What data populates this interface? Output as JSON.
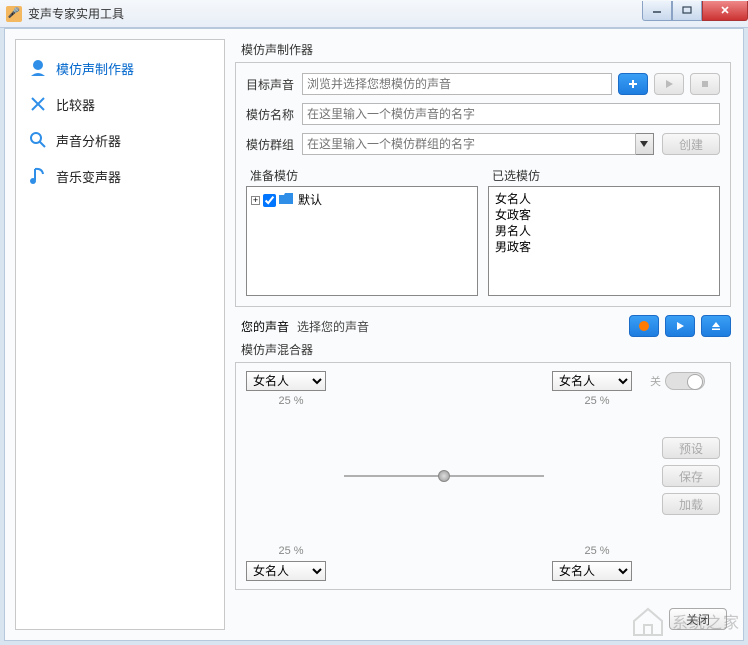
{
  "window": {
    "title": "变声专家实用工具"
  },
  "sidebar": {
    "items": [
      {
        "label": "模仿声制作器"
      },
      {
        "label": "比较器"
      },
      {
        "label": "声音分析器"
      },
      {
        "label": "音乐变声器"
      }
    ]
  },
  "maker": {
    "section_title": "模仿声制作器",
    "target_label": "目标声音",
    "target_placeholder": "浏览并选择您想模仿的声音",
    "name_label": "模仿名称",
    "name_placeholder": "在这里输入一个模仿声音的名字",
    "group_label": "模仿群组",
    "group_placeholder": "在这里输入一个模仿群组的名字",
    "create_btn": "创建",
    "prepare_label": "准备模仿",
    "tree_default": "默认",
    "selected_label": "已选模仿",
    "selected_items": [
      "女名人",
      "女政客",
      "男名人",
      "男政客"
    ],
    "your_voice_label": "您的声音",
    "your_voice_value": "选择您的声音"
  },
  "mixer": {
    "title": "模仿声混合器",
    "selects": {
      "tl": "女名人",
      "tr": "女名人",
      "bl": "女名人",
      "br": "女名人"
    },
    "pct": "25 %",
    "toggle_label": "关",
    "btn_preset": "预设",
    "btn_save": "保存",
    "btn_load": "加载"
  },
  "footer": {
    "close": "关闭"
  },
  "watermark": {
    "text": "系统之家"
  }
}
